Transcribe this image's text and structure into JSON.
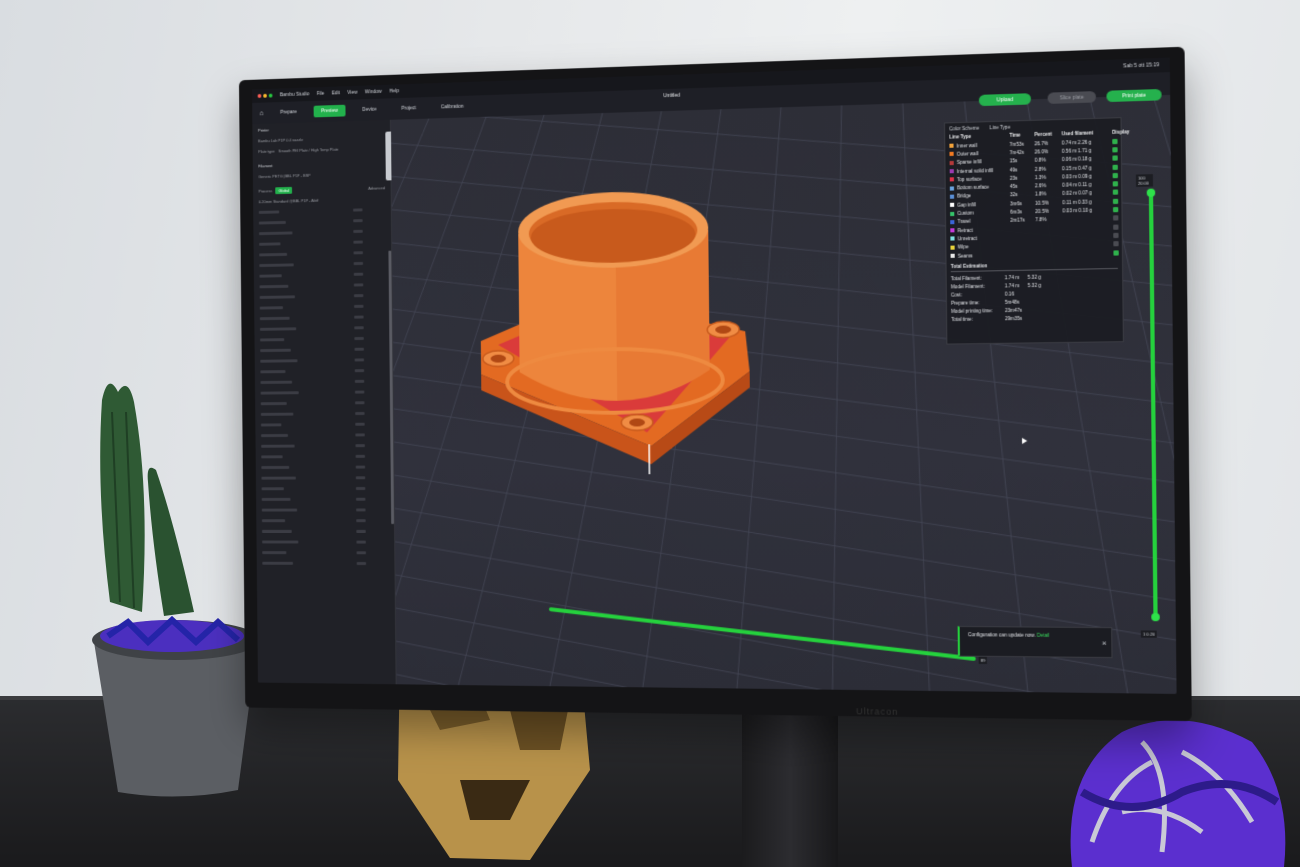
{
  "app": {
    "menu": [
      "Bambu Studio",
      "File",
      "Edit",
      "View",
      "Window",
      "Help"
    ],
    "clock": "Sab 5 ott  15:19",
    "window_title": "Untitled",
    "tabs": [
      {
        "label": "Prepare",
        "active": false
      },
      {
        "label": "Preview",
        "active": true
      },
      {
        "label": "Device",
        "active": false
      },
      {
        "label": "Project",
        "active": false
      },
      {
        "label": "Calibration",
        "active": false
      }
    ],
    "buttons": {
      "upload": "Upload",
      "slice": "Slice plate",
      "print": "Print plate"
    }
  },
  "sidebar": {
    "printer_title": "Printer",
    "printer_name": "Bambu Lab P1P 0.4 nozzle",
    "plate_label": "Plate type",
    "plate_value": "Smooth PEI Plate / High Temp Plate",
    "filament_title": "Filament",
    "filament_name": "Generic PETG (BBL P1P - BSP",
    "process_label": "Process",
    "process_badge": "Global",
    "advanced_label": "Advanced",
    "profile_name": "0.20mm Standard @BBL P1P - Aktif"
  },
  "legend": {
    "color_scheme_label": "Color Scheme",
    "color_scheme_value": "Line Type",
    "columns": [
      "Line Type",
      "Time",
      "Percent",
      "Used filament",
      "Display"
    ],
    "rows": [
      {
        "name": "Inner wall",
        "time": "7m53s",
        "percent": "26.7%",
        "used": "0.74 m   2.26 g",
        "color": "#f2a23a",
        "display": true
      },
      {
        "name": "Outer wall",
        "time": "7m42s",
        "percent": "26.0%",
        "used": "0.56 m   1.71 g",
        "color": "#f27a22",
        "display": true
      },
      {
        "name": "Sparse infill",
        "time": "15s",
        "percent": "0.8%",
        "used": "0.06 m   0.18 g",
        "color": "#b43a3a",
        "display": true
      },
      {
        "name": "Internal solid infill",
        "time": "49s",
        "percent": "2.8%",
        "used": "0.15 m   0.47 g",
        "color": "#9b3ab0",
        "display": true
      },
      {
        "name": "Top surface",
        "time": "23s",
        "percent": "1.3%",
        "used": "0.03 m   0.09 g",
        "color": "#e0314a",
        "display": true
      },
      {
        "name": "Bottom surface",
        "time": "45s",
        "percent": "2.6%",
        "used": "0.04 m   0.11 g",
        "color": "#6aa3e0",
        "display": true
      },
      {
        "name": "Bridge",
        "time": "32s",
        "percent": "1.8%",
        "used": "0.02 m   0.07 g",
        "color": "#5a8fd6",
        "display": true
      },
      {
        "name": "Gap infill",
        "time": "3m6s",
        "percent": "10.5%",
        "used": "0.11 m   0.33 g",
        "color": "#ffffff",
        "display": true
      },
      {
        "name": "Custom",
        "time": "6m3s",
        "percent": "20.5%",
        "used": "0.03 m   0.10 g",
        "color": "#35c46a",
        "display": true
      },
      {
        "name": "Travel",
        "time": "2m17s",
        "percent": "7.8%",
        "used": "",
        "color": "#3a64d8",
        "display": false
      },
      {
        "name": "Retract",
        "time": "",
        "percent": "",
        "used": "",
        "color": "#c43ad8",
        "display": false
      },
      {
        "name": "Unretract",
        "time": "",
        "percent": "",
        "used": "",
        "color": "#7fe0e0",
        "display": false
      },
      {
        "name": "Wipe",
        "time": "",
        "percent": "",
        "used": "",
        "color": "#e8d23a",
        "display": false
      },
      {
        "name": "Seams",
        "time": "",
        "percent": "",
        "used": "",
        "color": "#e8e8e8",
        "display": true
      }
    ],
    "estimation_title": "Total Estimation",
    "estimation": [
      {
        "label": "Total Filament:",
        "a": "1.74 m",
        "b": "5.32 g"
      },
      {
        "label": "Model Filament:",
        "a": "1.74 m",
        "b": "5.32 g"
      },
      {
        "label": "Cost:",
        "a": "0.16",
        "b": ""
      },
      {
        "label": "Prepare time:",
        "a": "5m48s",
        "b": ""
      },
      {
        "label": "Model printing time:",
        "a": "23m47s",
        "b": ""
      },
      {
        "label": "Total time:",
        "a": "29m35s",
        "b": ""
      }
    ]
  },
  "slider": {
    "top_layer": "100",
    "top_height": "20.00",
    "bottom_layer": "1",
    "bottom_height": "0.20",
    "h_value": "89"
  },
  "notice": {
    "text": "Configuration can update now.",
    "link": "Detail"
  },
  "monitor_brand": "Ultracon",
  "colors": {
    "accent": "#25b14d",
    "model_orange": "#ee7a2f",
    "model_red": "#d8323e",
    "viewport": "#2d2e37"
  }
}
